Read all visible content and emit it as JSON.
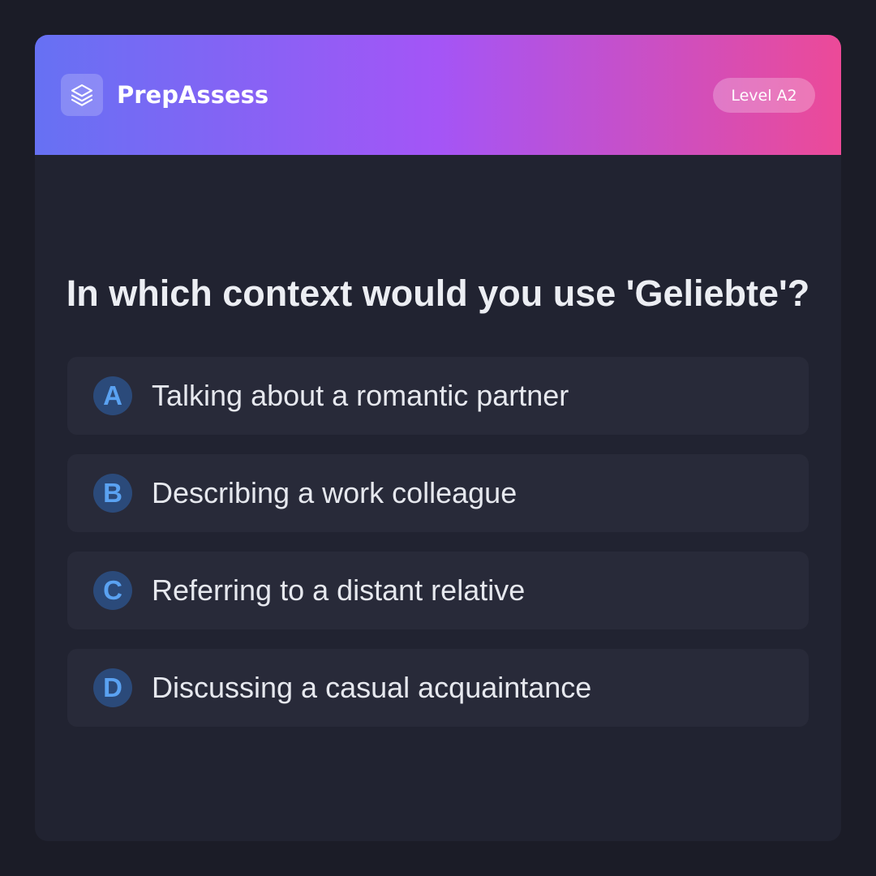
{
  "header": {
    "logo_icon": "layers-icon",
    "brand": "PrepAssess",
    "level_badge": "Level A2",
    "gradient_colors": [
      "#6671f3",
      "#a455f6",
      "#ec4a98"
    ]
  },
  "question": {
    "text": "In which context would you use 'Geliebte'?"
  },
  "options": [
    {
      "letter": "A",
      "text": "Talking about a romantic partner"
    },
    {
      "letter": "B",
      "text": "Describing a work colleague"
    },
    {
      "letter": "C",
      "text": "Referring to a distant relative"
    },
    {
      "letter": "D",
      "text": "Discussing a casual acquaintance"
    }
  ],
  "colors": {
    "background": "#1b1c27",
    "card": "#212331",
    "option_bg": "#282a39",
    "letter_circle": "#2b4a7a",
    "letter_text": "#5aa2f2"
  }
}
